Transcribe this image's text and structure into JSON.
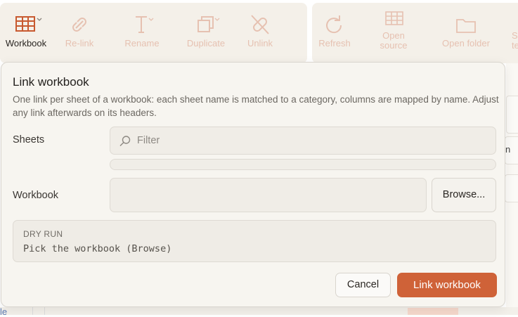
{
  "toolbar": {
    "buttons": [
      {
        "label": "Workbook",
        "icon": "table-icon"
      },
      {
        "label": "Re-link",
        "icon": "link-icon"
      },
      {
        "label": "Rename",
        "icon": "text-cursor-icon"
      },
      {
        "label": "Duplicate",
        "icon": "copy-icon"
      },
      {
        "label": "Unlink",
        "icon": "unlink-icon"
      },
      {
        "label": "Refresh",
        "icon": "refresh-icon"
      },
      {
        "label": "Open\nsource",
        "icon": "grid-icon"
      },
      {
        "label": "Open folder",
        "icon": "folder-icon"
      },
      {
        "label": "Sa\ntem",
        "icon": "template-icon"
      }
    ]
  },
  "background": {
    "fragment_right": "n",
    "fragment_left": "le"
  },
  "dialog": {
    "title": "Link workbook",
    "description": "One link per sheet of a workbook: each sheet name is matched to a category, columns are mapped by name. Adjust any link afterwards on its headers.",
    "sheets_label": "Sheets",
    "filter_placeholder": "Filter",
    "workbook_label": "Workbook",
    "workbook_value": "",
    "browse_label": "Browse...",
    "dry_run_title": "DRY RUN",
    "dry_run_message": "Pick the workbook (Browse)",
    "cancel_label": "Cancel",
    "primary_label": "Link workbook"
  },
  "colors": {
    "accent": "#cf6238",
    "dialog_bg": "#f7f5f0",
    "toolbar_bg": "#f4f0e9",
    "disabled_icon": "#e6c1b1"
  }
}
